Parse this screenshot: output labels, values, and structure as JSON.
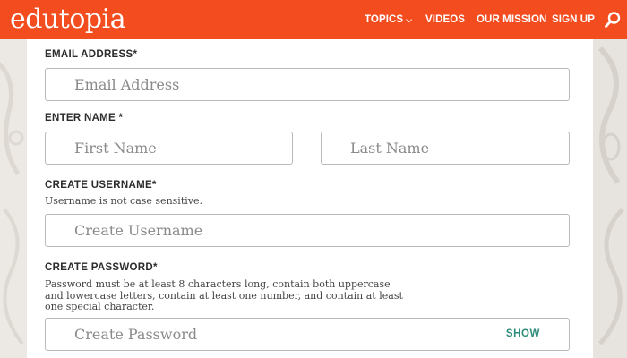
{
  "header": {
    "logo": "edutopia",
    "nav": [
      {
        "label": "TOPICS",
        "has_dropdown": true
      },
      {
        "label": "VIDEOS"
      },
      {
        "label": "OUR MISSION"
      },
      {
        "label": "SIGN UP"
      }
    ],
    "search_icon": "search-icon",
    "colors": {
      "brand": "#f24c1f"
    }
  },
  "form": {
    "email": {
      "label": "EMAIL ADDRESS*",
      "placeholder": "Email Address",
      "value": ""
    },
    "name": {
      "label": "ENTER NAME *",
      "first_placeholder": "First Name",
      "last_placeholder": "Last Name"
    },
    "username": {
      "label": "CREATE USERNAME*",
      "help": "Username is not case sensitive.",
      "placeholder": "Create Username"
    },
    "password": {
      "label": "CREATE PASSWORD*",
      "help_lines": [
        "Password must be at least 8 characters long, contain both uppercase",
        "and lowercase letters, contain at least one number, and contain at least",
        "one special character."
      ],
      "placeholder": "Create Password",
      "show_label": "SHOW"
    },
    "colors": {
      "accent": "#2f8c7b"
    }
  }
}
